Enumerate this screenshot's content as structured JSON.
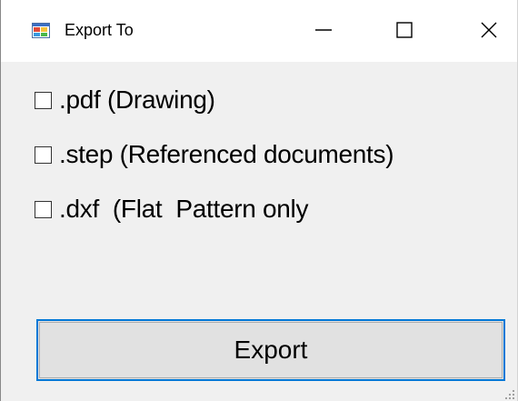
{
  "window": {
    "title": "Export To",
    "title_icon": "windows-form-icon",
    "controls": {
      "minimize_icon": "minimize-icon",
      "maximize_icon": "maximize-icon",
      "close_icon": "close-icon"
    }
  },
  "options": [
    {
      "label": ".pdf (Drawing)",
      "checked": false
    },
    {
      "label": ".step (Referenced documents)",
      "checked": false
    },
    {
      "label": ".dxf  (Flat  Pattern only",
      "checked": false
    }
  ],
  "export_button": {
    "label": "Export",
    "focus_color": "#0078d7"
  }
}
